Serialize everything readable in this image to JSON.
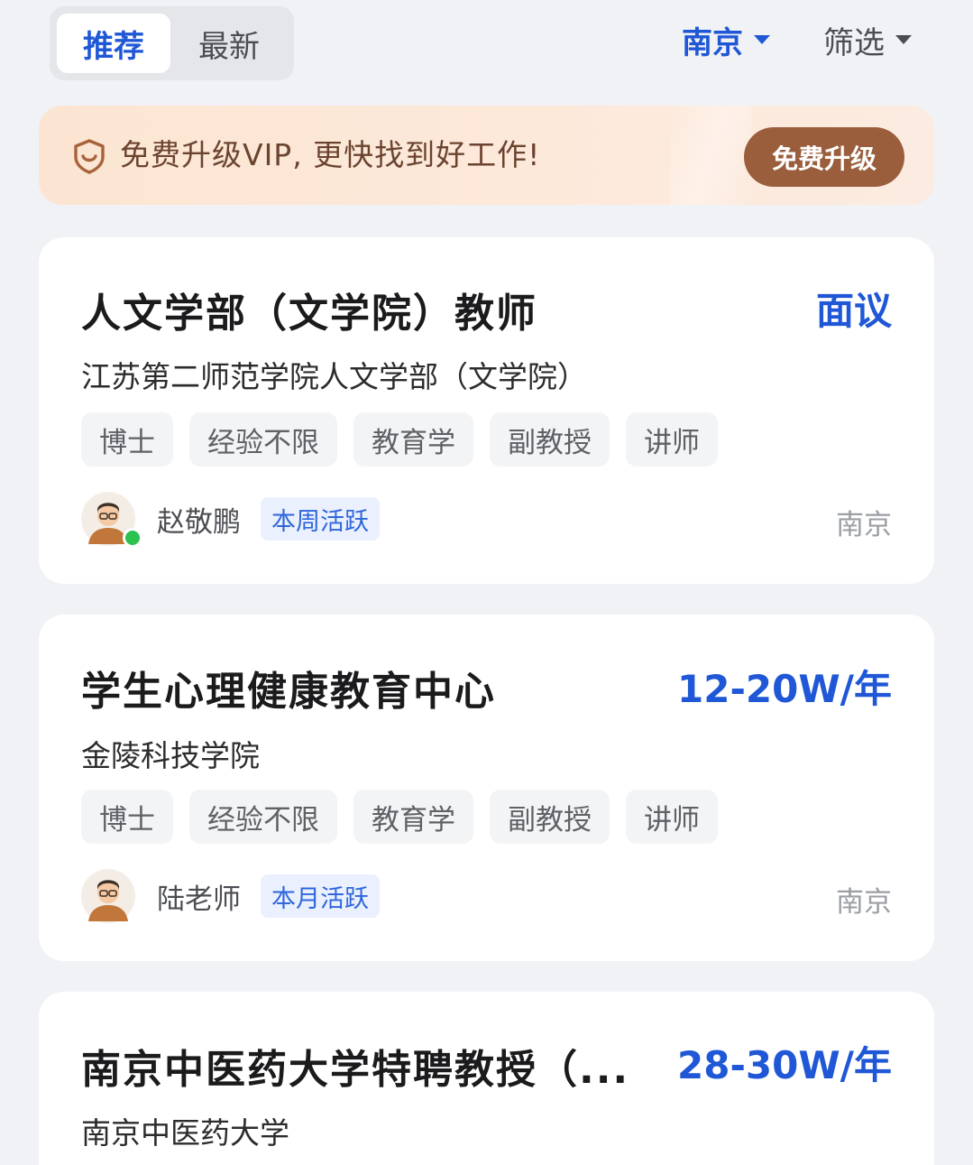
{
  "tabs": {
    "recommend": "推荐",
    "latest": "最新"
  },
  "header": {
    "city": "南京",
    "filter": "筛选"
  },
  "vip": {
    "text": "免费升级VIP, 更快找到好工作!",
    "button": "免费升级",
    "icon": "shield-smile-icon"
  },
  "jobs": [
    {
      "title": "人文学部（文学院）教师",
      "salary": "面议",
      "company": "江苏第二师范学院人文学部（文学院）",
      "tags": [
        "博士",
        "经验不限",
        "教育学",
        "副教授",
        "讲师"
      ],
      "recruiter": "赵敬鹏",
      "activity": "本周活跃",
      "online": true,
      "location": "南京"
    },
    {
      "title": "学生心理健康教育中心",
      "salary": "12-20W/年",
      "company": "金陵科技学院",
      "tags": [
        "博士",
        "经验不限",
        "教育学",
        "副教授",
        "讲师"
      ],
      "recruiter": "陆老师",
      "activity": "本月活跃",
      "online": false,
      "location": "南京"
    },
    {
      "title": "南京中医药大学特聘教授（...",
      "salary": "28-30W/年",
      "company": "南京中医药大学"
    }
  ],
  "colors": {
    "accent": "#1f57d6",
    "vip_button": "#9a5e3d",
    "online": "#2cc24f"
  }
}
